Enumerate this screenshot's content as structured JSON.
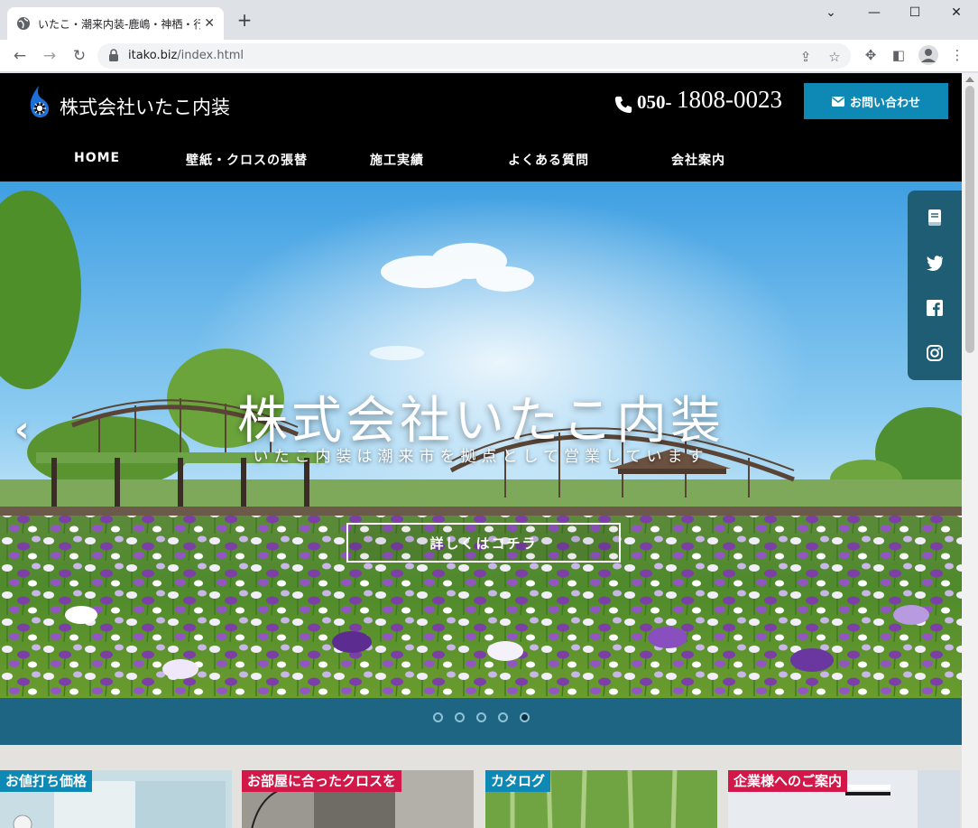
{
  "browser": {
    "tab_title": "いたこ・潮来内装-鹿嶋・神栖・行方",
    "url_host": "itako.biz",
    "url_path": "/index.html",
    "new_tab": "+",
    "close_tab": "✕"
  },
  "site": {
    "name": "株式会社いたこ内装",
    "phone_prefix": "050-",
    "phone_number": "1808-0023",
    "contact_label": "お問い合わせ"
  },
  "nav": {
    "items": [
      {
        "label": "HOME"
      },
      {
        "label": "壁紙・クロスの張替"
      },
      {
        "label": "施工実績"
      },
      {
        "label": "よくある質問"
      },
      {
        "label": "会社案内"
      }
    ]
  },
  "hero": {
    "title": "株式会社いたこ内装",
    "subtitle": "いたこ内装は潮来市を拠点として営業しています",
    "button_label": "詳しくはコチラ",
    "prev_arrow": "‹",
    "slide_count": 5,
    "active_slide": 5
  },
  "social": {
    "items": [
      "book-icon",
      "twitter-icon",
      "facebook-icon",
      "instagram-icon"
    ]
  },
  "cards": [
    {
      "label": "お値打ち価格",
      "color": "#0e89b5"
    },
    {
      "label": "お部屋に合ったクロスを",
      "color": "#d21848"
    },
    {
      "label": "カタログ",
      "color": "#0e89b5"
    },
    {
      "label": "企業様へのご案内",
      "color": "#d21848"
    }
  ],
  "colors": {
    "accent_blue": "#0e89b5",
    "accent_red": "#d21848",
    "header_bg": "#000000",
    "band_bg": "#1e6483",
    "social_bg": "#1f5d74"
  }
}
